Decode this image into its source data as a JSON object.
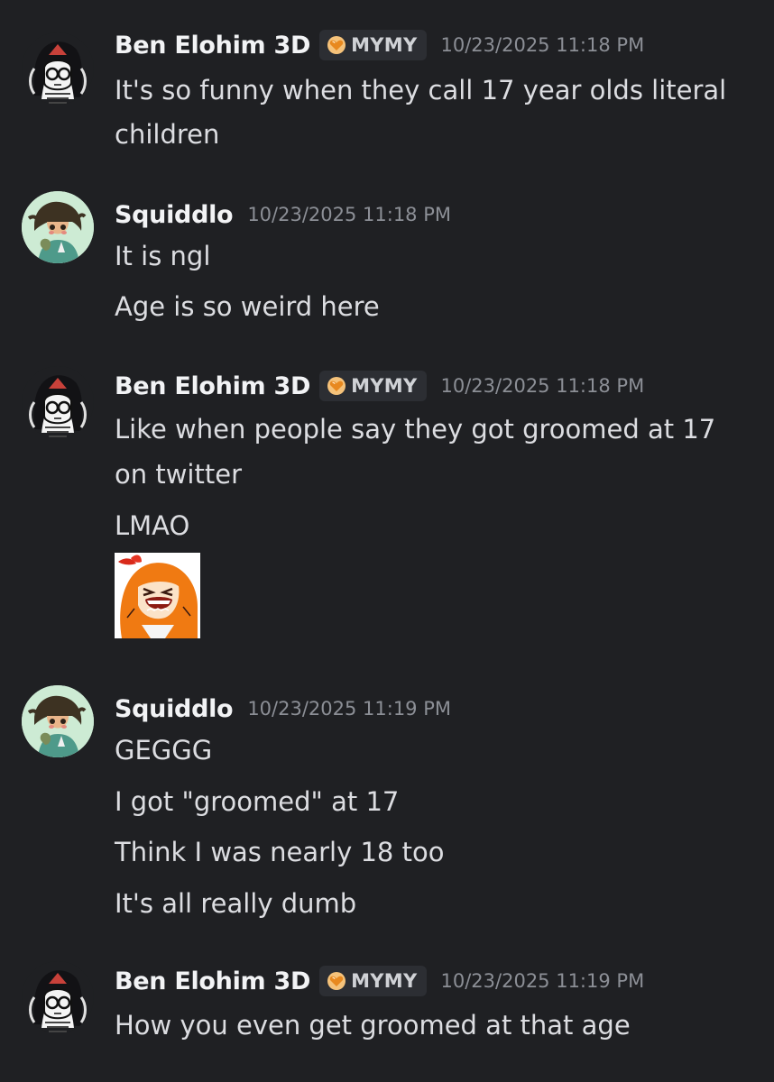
{
  "messages": [
    {
      "username": "Ben Elohim 3D",
      "tag": "MYMY",
      "timestamp": "10/23/2025 11:18 PM",
      "lines": [
        "It's so funny when they call 17 year olds literal",
        "children"
      ]
    },
    {
      "username": "Squiddlo",
      "timestamp": "10/23/2025 11:18 PM",
      "lines": [
        "It is ngl",
        "Age is so weird here"
      ]
    },
    {
      "username": "Ben Elohim 3D",
      "tag": "MYMY",
      "timestamp": "10/23/2025 11:18 PM",
      "lines": [
        "Like when people say they got groomed at 17",
        "on twitter",
        "LMAO"
      ],
      "attachment": "laughing-girl-sticker"
    },
    {
      "username": "Squiddlo",
      "timestamp": "10/23/2025 11:19 PM",
      "lines": [
        "GEGGG",
        "I got \"groomed\" at 17",
        "Think I was nearly 18 too",
        "It's all really dumb"
      ]
    },
    {
      "username": "Ben Elohim 3D",
      "tag": "MYMY",
      "timestamp": "10/23/2025 11:19 PM",
      "lines": [
        "How you even get groomed at that age"
      ]
    }
  ],
  "colors": {
    "background": "#1f2023",
    "username": "#f2f3f5",
    "message_text": "#dcdde1",
    "timestamp": "#8c8f96",
    "tag_background": "#2c2e33",
    "tag_icon": "#f0a440"
  },
  "icons": {
    "tag_icon": "heart-badge-icon",
    "avatar_ben": "sketch-girl-avatar",
    "avatar_squid": "cartoon-girl-avatar"
  }
}
